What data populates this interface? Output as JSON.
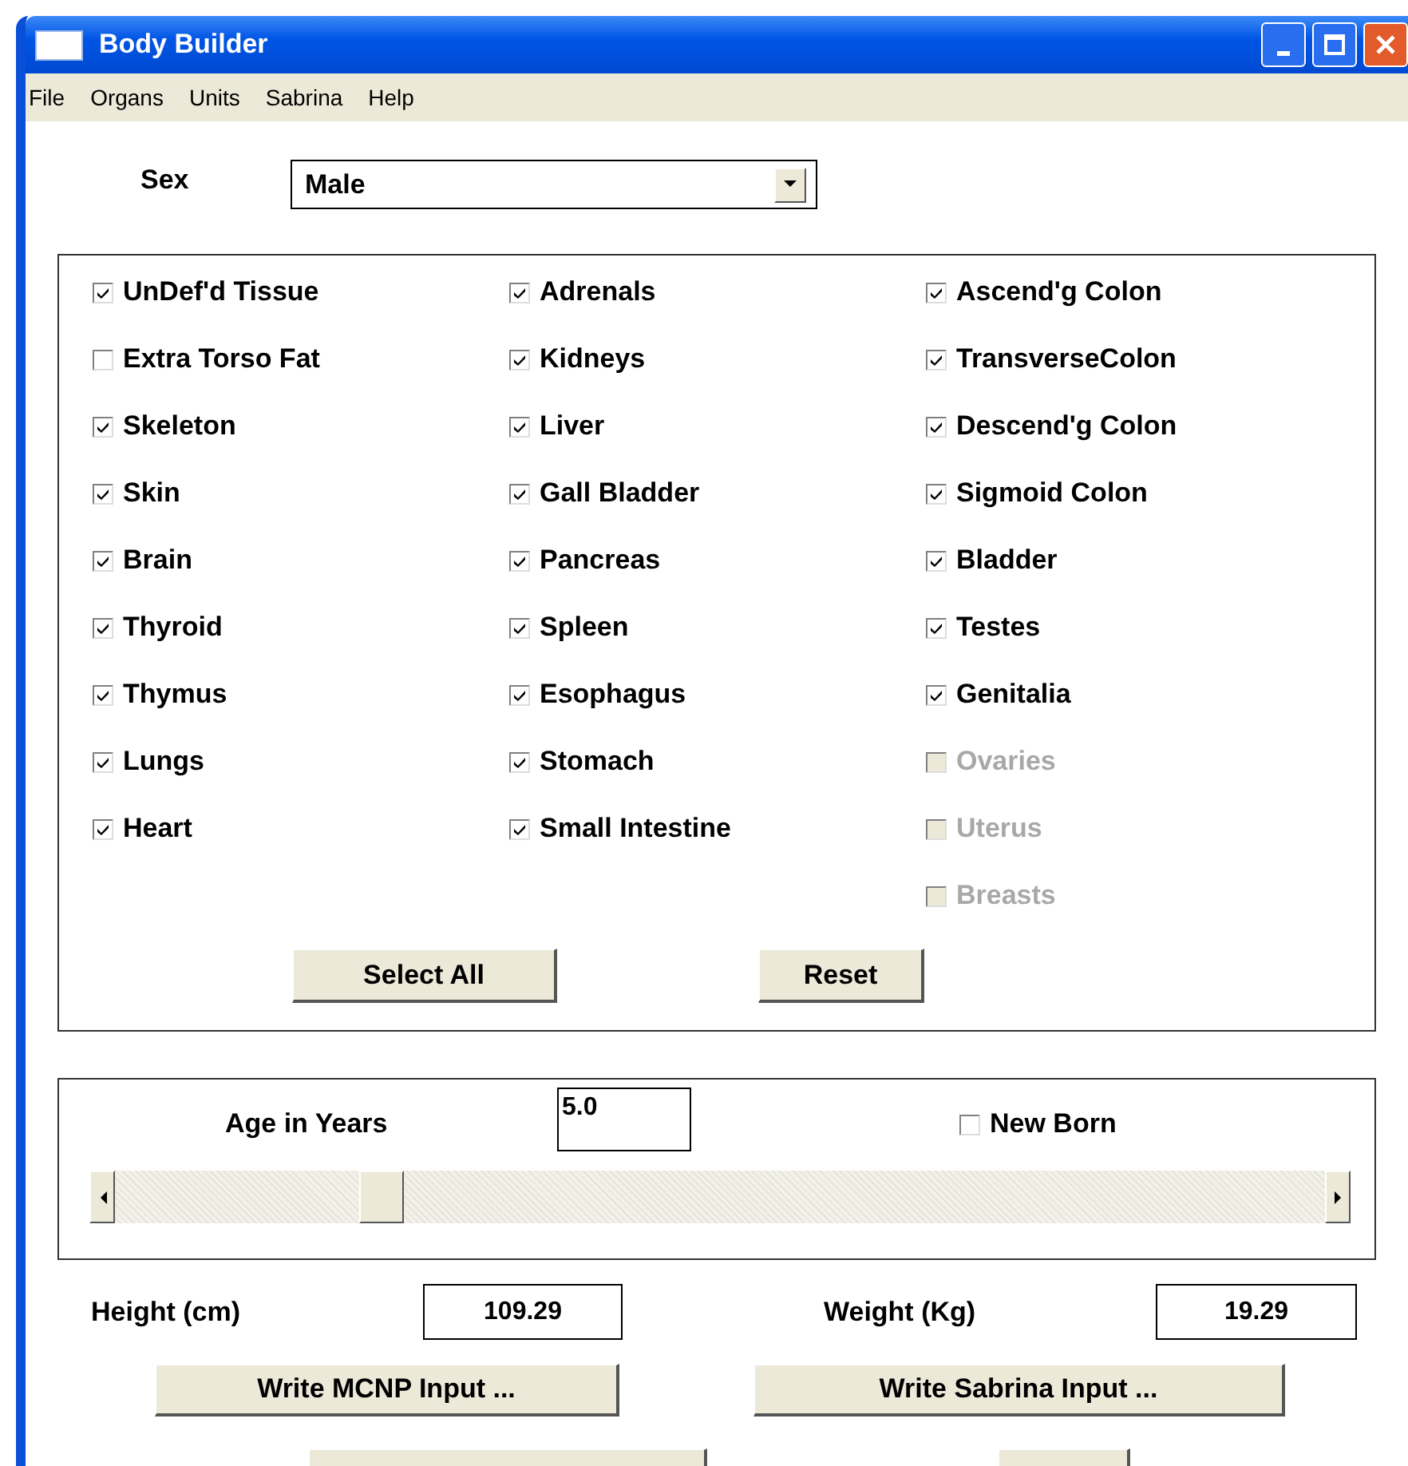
{
  "window": {
    "title": "Body Builder"
  },
  "menu": [
    "File",
    "Organs",
    "Units",
    "Sabrina",
    "Help"
  ],
  "sex": {
    "label": "Sex",
    "value": "Male"
  },
  "organ_columns": [
    [
      {
        "label": "UnDef'd Tissue",
        "checked": true,
        "disabled": false
      },
      {
        "label": "Extra Torso Fat",
        "checked": false,
        "disabled": false
      },
      {
        "label": "Skeleton",
        "checked": true,
        "disabled": false
      },
      {
        "label": "Skin",
        "checked": true,
        "disabled": false
      },
      {
        "label": "Brain",
        "checked": true,
        "disabled": false
      },
      {
        "label": "Thyroid",
        "checked": true,
        "disabled": false
      },
      {
        "label": "Thymus",
        "checked": true,
        "disabled": false
      },
      {
        "label": "Lungs",
        "checked": true,
        "disabled": false
      },
      {
        "label": "Heart",
        "checked": true,
        "disabled": false
      }
    ],
    [
      {
        "label": "Adrenals",
        "checked": true,
        "disabled": false
      },
      {
        "label": "Kidneys",
        "checked": true,
        "disabled": false
      },
      {
        "label": "Liver",
        "checked": true,
        "disabled": false
      },
      {
        "label": "Gall Bladder",
        "checked": true,
        "disabled": false
      },
      {
        "label": "Pancreas",
        "checked": true,
        "disabled": false
      },
      {
        "label": "Spleen",
        "checked": true,
        "disabled": false
      },
      {
        "label": "Esophagus",
        "checked": true,
        "disabled": false
      },
      {
        "label": "Stomach",
        "checked": true,
        "disabled": false
      },
      {
        "label": "Small Intestine",
        "checked": true,
        "disabled": false
      }
    ],
    [
      {
        "label": "Ascend'g Colon",
        "checked": true,
        "disabled": false
      },
      {
        "label": "TransverseColon",
        "checked": true,
        "disabled": false
      },
      {
        "label": "Descend'g Colon",
        "checked": true,
        "disabled": false
      },
      {
        "label": "Sigmoid Colon",
        "checked": true,
        "disabled": false
      },
      {
        "label": "Bladder",
        "checked": true,
        "disabled": false
      },
      {
        "label": "Testes",
        "checked": true,
        "disabled": false
      },
      {
        "label": "Genitalia",
        "checked": true,
        "disabled": false
      },
      {
        "label": "Ovaries",
        "checked": false,
        "disabled": true
      },
      {
        "label": "Uterus",
        "checked": false,
        "disabled": true
      },
      {
        "label": "Breasts",
        "checked": false,
        "disabled": true
      }
    ]
  ],
  "organ_buttons": [
    "Select All",
    "Reset"
  ],
  "age": {
    "label": "Age in Years",
    "value": "5.0",
    "new_born": {
      "label": "New Born",
      "checked": false
    },
    "slider": {
      "level": 0.21
    }
  },
  "height": {
    "label": "Height (cm)",
    "value": "109.29"
  },
  "weight": {
    "label": "Weight (Kg)",
    "value": "19.29"
  },
  "write_buttons": [
    "Write MCNP Input ...",
    "Write Sabrina Input ..."
  ]
}
